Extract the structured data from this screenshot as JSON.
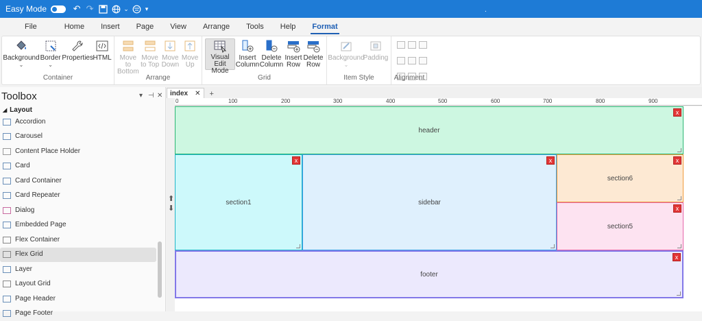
{
  "titlebar": {
    "easy_mode": "Easy Mode",
    "dot": "."
  },
  "menu": [
    "File",
    "Home",
    "Insert",
    "Page",
    "View",
    "Arrange",
    "Tools",
    "Help",
    "Format"
  ],
  "ribbon": {
    "container": {
      "label": "Container",
      "buttons": [
        "Background",
        "Border",
        "Properties",
        "HTML"
      ]
    },
    "arrange": {
      "label": "Arrange",
      "buttons": [
        "Move to Bottom",
        "Move to Top",
        "Move Down",
        "Move Up"
      ]
    },
    "grid": {
      "label": "Grid",
      "buttons": [
        "Visual Edit Mode",
        "Insert Column",
        "Delete Column",
        "Insert Row",
        "Delete Row"
      ]
    },
    "item_style": {
      "label": "Item Style",
      "buttons": [
        "Background",
        "Padding"
      ]
    },
    "alignment": {
      "label": "Alignment"
    }
  },
  "toolbox": {
    "title": "Toolbox",
    "section": "Layout",
    "items": [
      "Accordion",
      "Carousel",
      "Content Place Holder",
      "Card",
      "Card Container",
      "Card Repeater",
      "Dialog",
      "Embedded Page",
      "Flex Container",
      "Flex Grid",
      "Layer",
      "Layout Grid",
      "Page Header",
      "Page Footer"
    ]
  },
  "editor": {
    "tab": "index",
    "ruler": [
      "0",
      "100",
      "200",
      "300",
      "400",
      "500",
      "600",
      "700",
      "800",
      "900"
    ],
    "cells": {
      "header": "header",
      "section1": "section1",
      "sidebar": "sidebar",
      "section6": "section6",
      "section5": "section5",
      "footer": "footer"
    },
    "delete_label": "x"
  },
  "colors": {
    "accent": "#1e7bd6",
    "header_bg": "#cdf7e1",
    "header_border": "#2bb673",
    "section1_bg": "#cdf9fb",
    "section1_border": "#22b5c8",
    "sidebar_bg": "#dff0fd",
    "sidebar_border": "#3a9ee6",
    "section6_bg": "#fde9d3",
    "section6_border": "#f09a3a",
    "section5_bg": "#fde3f1",
    "section5_border": "#e565a9",
    "footer_bg": "#ece9fd",
    "footer_border": "#8277e8"
  }
}
